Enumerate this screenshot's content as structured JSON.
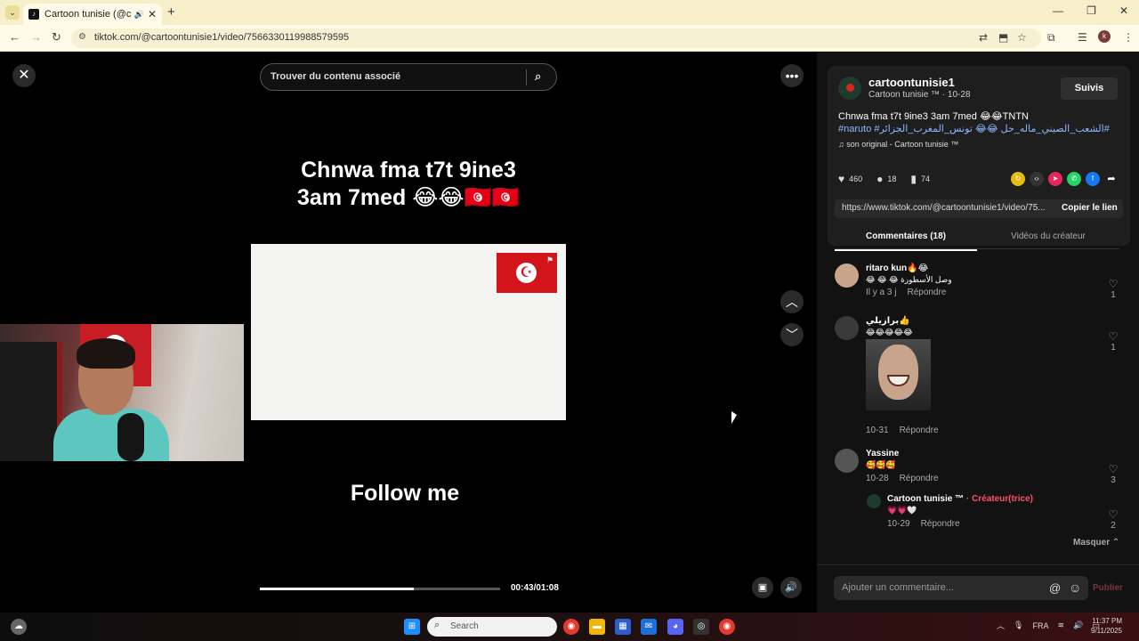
{
  "browser": {
    "tab_title": "Cartoon tunisie (@ca",
    "url": "tiktok.com/@cartoontunisie1/video/7566330119988579595",
    "profile_initial": "k"
  },
  "search": {
    "placeholder": "Trouver du contenu associé"
  },
  "video": {
    "caption_line1": "Chnwa fma t7t 9ine3",
    "caption_line2": "3am 7med 😂😂🇹🇳🇹🇳",
    "follow_text": "Follow me",
    "time": "00:43/01:08",
    "progress": 0.64
  },
  "creator": {
    "username": "cartoontunisie1",
    "subline": "Cartoon tunisie ™ · 10-28",
    "follow_label": "Suivis",
    "description": "Chnwa fma t7t 9ine3 3am 7med 😂😂TNTN",
    "hashtags": "#naruto #الشعب_الصيني_ماله_حل 😂😂 تونس_المغرب_الجزائر#",
    "sound": "♫  son original - Cartoon tunisie ™"
  },
  "stats": {
    "likes": "460",
    "comments": "18",
    "saves": "74"
  },
  "link": {
    "url": "https://www.tiktok.com/@cartoontunisie1/video/75...",
    "copy_label": "Copier le lien"
  },
  "tabs": {
    "comments": "Commentaires (18)",
    "videos": "Vidéos du créateur"
  },
  "comments": [
    {
      "name": "ritaro kun🔥😂",
      "text": "😂 😂 😂 وصل الأسطورة",
      "date": "Il y a 3 j",
      "reply": "Répondre",
      "likes": "1"
    },
    {
      "name": "برازيلي👍",
      "text": "😂😂😂😂😂",
      "date": "10-31",
      "reply": "Répondre",
      "likes": "1"
    },
    {
      "name": "Yassine",
      "text": "🥰🥰🥰",
      "date": "10-28",
      "reply": "Répondre",
      "likes": "3"
    },
    {
      "name": "Cartoon tunisie ™",
      "creator_tag": "· Créateur(trice)",
      "text": "💗💗🤍",
      "date": "10-29",
      "reply": "Répondre",
      "likes": "2"
    }
  ],
  "masquer": "Masquer ⌃",
  "composer": {
    "placeholder": "Ajouter un commentaire...",
    "publish": "Publier"
  },
  "taskbar": {
    "search": "Search",
    "lang": "FRA",
    "time": "11:37 PM",
    "date": "9/11/2025"
  }
}
